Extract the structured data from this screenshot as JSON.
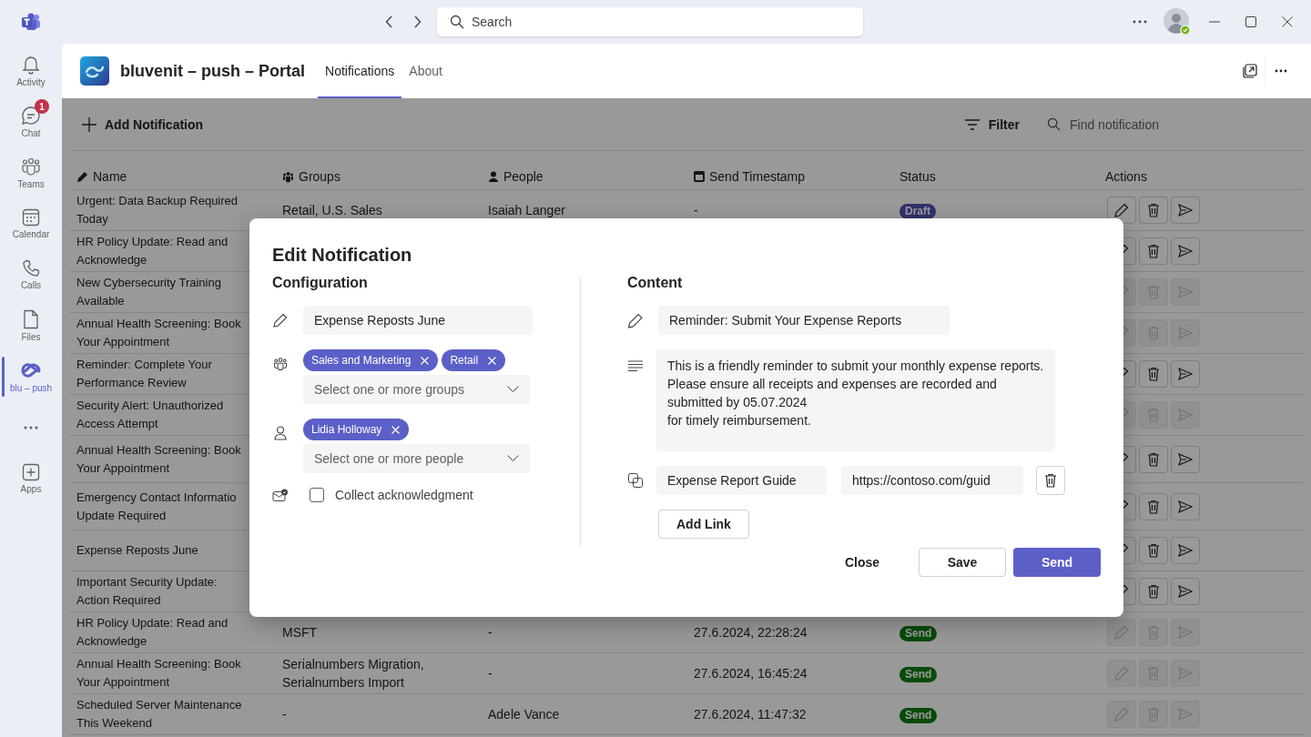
{
  "titlebar": {
    "search_placeholder": "Search"
  },
  "rail": [
    {
      "label": "Activity",
      "selected": false
    },
    {
      "label": "Chat",
      "selected": false,
      "badge": "1"
    },
    {
      "label": "Teams",
      "selected": false
    },
    {
      "label": "Calendar",
      "selected": false
    },
    {
      "label": "Calls",
      "selected": false
    },
    {
      "label": "Files",
      "selected": false
    },
    {
      "label": "blu – push",
      "selected": true
    },
    {
      "label": "Apps",
      "selected": false
    }
  ],
  "app": {
    "title": "bluvenit – push – Portal",
    "tabs": [
      {
        "label": "Notifications",
        "selected": true
      },
      {
        "label": "About",
        "selected": false
      }
    ]
  },
  "toolbar": {
    "add_button": "Add Notification",
    "filter_button": "Filter",
    "search_placeholder": "Find notification"
  },
  "table": {
    "columns": [
      "Name",
      "Groups",
      "People",
      "Send Timestamp",
      "Status",
      "Actions"
    ],
    "rows": [
      {
        "name": "Urgent: Data Backup Required Today",
        "groups": "Retail, U.S. Sales",
        "people": "Isaiah Langer",
        "timestamp": "-",
        "status": {
          "label": "Draft",
          "kind": "draft"
        },
        "actions_enabled": true
      },
      {
        "name": "HR Policy Update: Read and Acknowledge",
        "actions_enabled": true
      },
      {
        "name": "New Cybersecurity Training Available",
        "actions_enabled": false
      },
      {
        "name": "Annual Health Screening: Book Your Appointment",
        "actions_enabled": false
      },
      {
        "name": "Reminder: Complete Your Performance Review",
        "actions_enabled": true
      },
      {
        "name": "Security Alert: Unauthorized Access Attempt",
        "actions_enabled": false
      },
      {
        "name": "Annual Health Screening: Book Your Appointment",
        "actions_enabled": true
      },
      {
        "name": "Emergency Contact Informatio Update Required",
        "actions_enabled": true
      },
      {
        "name": "Expense Reposts June",
        "actions_enabled": true
      },
      {
        "name": "Important Security Update: Action Required",
        "actions_enabled": true
      },
      {
        "name": "HR Policy Update: Read and Acknowledge",
        "groups": "MSFT",
        "people": "-",
        "timestamp": "27.6.2024, 22:28:24",
        "status": {
          "label": "Send",
          "kind": "sent"
        },
        "actions_enabled": false
      },
      {
        "name": "Annual Health Screening: Book Your Appointment",
        "groups": "Serialnumbers Migration, Serialnumbers Import",
        "people": "-",
        "timestamp": "27.6.2024, 16:45:24",
        "status": {
          "label": "Send",
          "kind": "sent"
        },
        "actions_enabled": false
      },
      {
        "name": "Scheduled Server Maintenance This Weekend",
        "groups": "-",
        "people": "Adele Vance",
        "timestamp": "27.6.2024, 11:47:32",
        "status": {
          "label": "Send",
          "kind": "sent"
        },
        "actions_enabled": false
      }
    ]
  },
  "dialog": {
    "title": "Edit Notification",
    "configuration": {
      "heading": "Configuration",
      "name_value": "Expense Reposts June",
      "groups": {
        "chips": [
          "Sales and Marketing",
          "Retail"
        ],
        "placeholder": "Select one or more groups"
      },
      "people": {
        "chips": [
          "Lidia Holloway"
        ],
        "placeholder": "Select one or more people"
      },
      "acknowledgment": {
        "label": "Collect acknowledgment",
        "checked": false
      }
    },
    "content": {
      "heading": "Content",
      "title_value": "Reminder: Submit Your Expense Reports",
      "body_value": "This is a friendly reminder to submit your monthly expense reports. Please ensure all receipts and expenses are recorded and submitted by 05.07.2024\nfor timely reimbursement.",
      "links": [
        {
          "label": "Expense Report Guide",
          "url": "https://contoso.com/guid"
        }
      ],
      "add_link": "Add Link"
    },
    "buttons": [
      {
        "label": "Close",
        "kind": "subtle"
      },
      {
        "label": "Save",
        "kind": "secondary"
      },
      {
        "label": "Send",
        "kind": "primary"
      }
    ]
  }
}
